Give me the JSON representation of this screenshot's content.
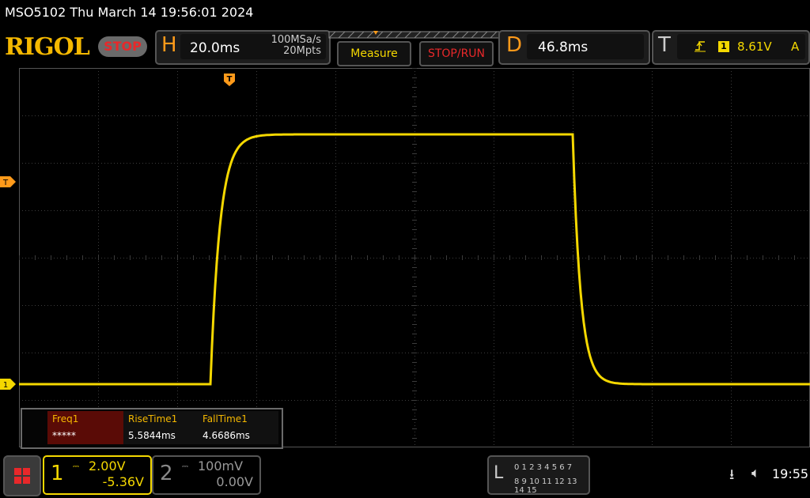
{
  "window": {
    "title": "MSO5102  Thu March 14 19:56:01 2024"
  },
  "brand": {
    "logo": "RIGOL",
    "run_state": "STOP"
  },
  "horizontal": {
    "letter": "H",
    "timebase": "20.0ms",
    "sample_rate": "100MSa/s",
    "memory_depth": "20Mpts"
  },
  "toolbar": {
    "measure_label": "Measure",
    "stoprun_label": "STOP/RUN"
  },
  "delay": {
    "letter": "D",
    "value": "46.8ms"
  },
  "trigger": {
    "letter": "T",
    "edge_icon": "rising-edge-icon",
    "source": "1",
    "level": "8.61V",
    "mode": "A"
  },
  "markers": {
    "ch1": "1",
    "trigger_level": "T",
    "trigger_position": "T"
  },
  "measurements": [
    {
      "name": "Freq1",
      "value": "*****"
    },
    {
      "name": "RiseTime1",
      "value": "5.5844ms"
    },
    {
      "name": "FallTime1",
      "value": "4.6686ms"
    }
  ],
  "channels": [
    {
      "number": "1",
      "scale": "2.00V",
      "offset": "-5.36V",
      "color": "#f5d800",
      "active": true
    },
    {
      "number": "2",
      "scale": "100mV",
      "offset": "0.00V",
      "color": "#888888",
      "active": false
    }
  ],
  "logic_analyzer": {
    "letter": "L",
    "row1": "0 1 2 3  4 5 6 7",
    "row2": "8 9 10 11 12 13 14 15"
  },
  "status": {
    "time": "19:55"
  },
  "colors": {
    "trace": "#f5d800",
    "accent": "#ff9a1a",
    "stop": "#e8282a",
    "grid": "#555555"
  }
}
